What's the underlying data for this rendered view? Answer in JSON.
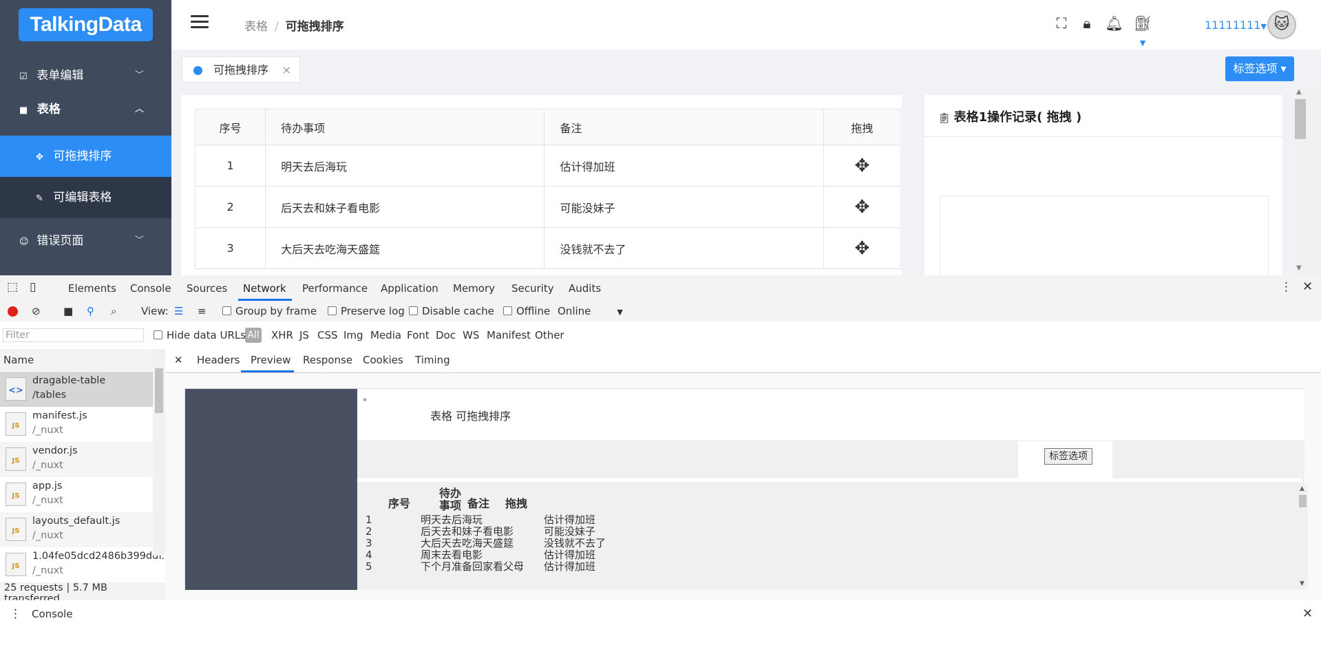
{
  "app": {
    "logo": "TalkingData",
    "sidebar": [
      {
        "label": "表单编辑",
        "icon": "checkbox-icon",
        "arrow": "⌄"
      },
      {
        "label": "表格",
        "icon": "table-icon",
        "arrow": "⌃"
      },
      {
        "label": "可拖拽排序",
        "icon": "move-icon"
      },
      {
        "label": "可编辑表格",
        "icon": "pencil-icon"
      },
      {
        "label": "错误页面",
        "icon": "smiley-icon",
        "arrow": "⌄"
      }
    ],
    "breadcrumb": {
      "parent": "表格",
      "sep": "/",
      "current": "可拖拽排序"
    },
    "user": "11111111",
    "tab": {
      "label": "可拖拽排序",
      "close": "×"
    },
    "tag_button": "标签选项 ▾",
    "table": {
      "headers": [
        "序号",
        "待办事项",
        "备注",
        "拖拽"
      ],
      "rows": [
        {
          "no": "1",
          "todo": "明天去后海玩",
          "note": "估计得加班"
        },
        {
          "no": "2",
          "todo": "后天去和妹子看电影",
          "note": "可能没妹子"
        },
        {
          "no": "3",
          "todo": "大后天去吃海天盛筵",
          "note": "没钱就不去了"
        }
      ]
    },
    "log_title": "表格1操作记录( 拖拽 )"
  },
  "devtools": {
    "tabs": [
      "Elements",
      "Console",
      "Sources",
      "Network",
      "Performance",
      "Application",
      "Memory",
      "Security",
      "Audits"
    ],
    "toolbar": {
      "view": "View:",
      "group": "Group by frame",
      "preserve": "Preserve log",
      "disable_cache": "Disable cache",
      "offline": "Offline",
      "throttle": "Online"
    },
    "filter": {
      "placeholder": "Filter",
      "hide": "Hide data URLs",
      "all": "All",
      "types": [
        "XHR",
        "JS",
        "CSS",
        "Img",
        "Media",
        "Font",
        "Doc",
        "WS",
        "Manifest",
        "Other"
      ]
    },
    "name_header": "Name",
    "requests": [
      {
        "name": "dragable-table",
        "path": "/tables",
        "kind": "doc"
      },
      {
        "name": "manifest.js",
        "path": "/_nuxt",
        "kind": "js"
      },
      {
        "name": "vendor.js",
        "path": "/_nuxt",
        "kind": "js"
      },
      {
        "name": "app.js",
        "path": "/_nuxt",
        "kind": "js"
      },
      {
        "name": "layouts_default.js",
        "path": "/_nuxt",
        "kind": "js"
      },
      {
        "name": "1.04fe05dcd2486b399ddf...",
        "path": "/_nuxt",
        "kind": "js"
      }
    ],
    "status": "25 requests  |  5.7 MB transferred  ...",
    "panel_tabs": [
      "Headers",
      "Preview",
      "Response",
      "Cookies",
      "Timing"
    ],
    "preview": {
      "breadcrumb": "表格  可拖拽排序",
      "button": "标签选项",
      "headers": [
        "序号",
        "待办事项",
        "备注",
        "拖拽"
      ],
      "rows": [
        {
          "no": "1",
          "todo": "明天去后海玩",
          "note": "估计得加班"
        },
        {
          "no": "2",
          "todo": "后天去和妹子看电影",
          "note": "可能没妹子"
        },
        {
          "no": "3",
          "todo": "大后天去吃海天盛筵",
          "note": "没钱就不去了"
        },
        {
          "no": "4",
          "todo": "周末去看电影",
          "note": "估计得加班"
        },
        {
          "no": "5",
          "todo": "下个月准备回家看父母",
          "note": "估计得加班"
        }
      ]
    },
    "drawer": "Console"
  }
}
